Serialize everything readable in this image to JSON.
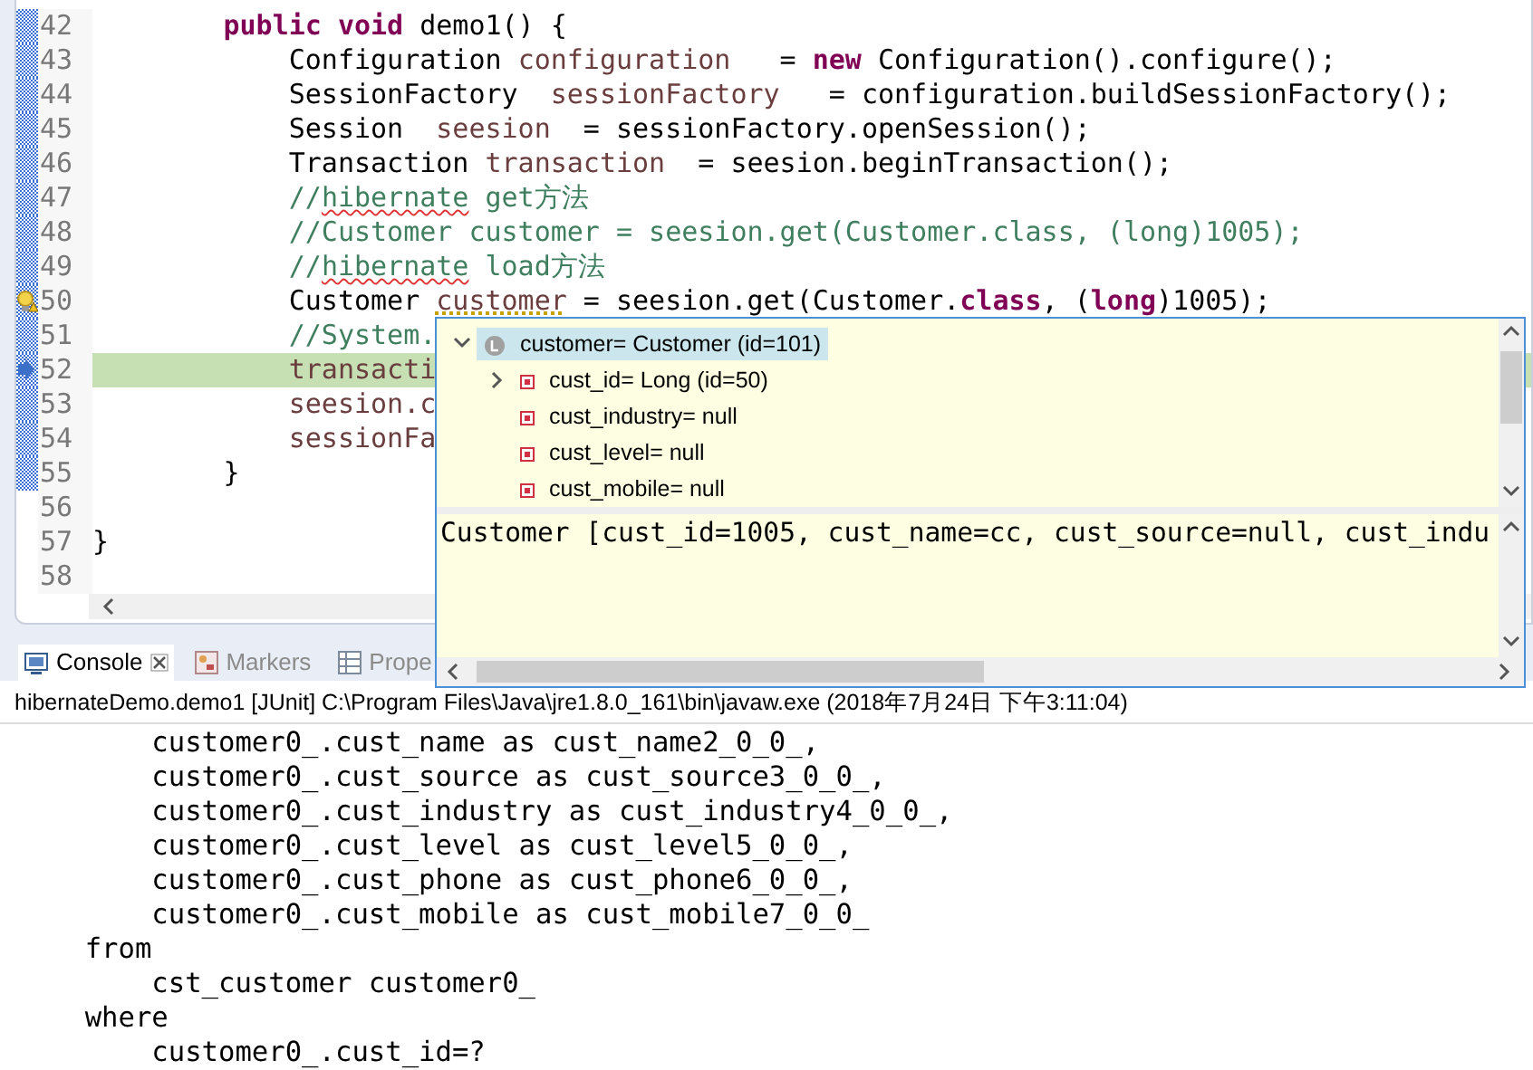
{
  "editor": {
    "lines": [
      {
        "number": "42",
        "in_range": true,
        "current": false,
        "segments": [
          {
            "kind": "keyword",
            "text": "        public"
          },
          {
            "kind": "keyword",
            "text": " void"
          },
          {
            "kind": "plain",
            "text": " demo1() {"
          }
        ]
      },
      {
        "number": "43",
        "in_range": true,
        "current": false,
        "segments": [
          {
            "kind": "plain",
            "text": "            Configuration "
          },
          {
            "kind": "variable",
            "text": "configuration"
          },
          {
            "kind": "plain",
            "text": "   = "
          },
          {
            "kind": "keyword",
            "text": "new"
          },
          {
            "kind": "plain",
            "text": " Configuration().configure();"
          }
        ]
      },
      {
        "number": "44",
        "in_range": true,
        "current": false,
        "segments": [
          {
            "kind": "plain",
            "text": "            SessionFactory  "
          },
          {
            "kind": "variable",
            "text": "sessionFactory"
          },
          {
            "kind": "plain",
            "text": "   = configuration.buildSessionFactory();"
          }
        ]
      },
      {
        "number": "45",
        "in_range": true,
        "current": false,
        "segments": [
          {
            "kind": "plain",
            "text": "            Session  "
          },
          {
            "kind": "variable",
            "text": "seesion"
          },
          {
            "kind": "plain",
            "text": "  = sessionFactory.openSession();"
          }
        ]
      },
      {
        "number": "46",
        "in_range": true,
        "current": false,
        "segments": [
          {
            "kind": "plain",
            "text": "            Transaction "
          },
          {
            "kind": "variable",
            "text": "transaction"
          },
          {
            "kind": "plain",
            "text": "  = seesion.beginTransaction();"
          }
        ]
      },
      {
        "number": "47",
        "in_range": true,
        "current": false,
        "segments": [
          {
            "kind": "comment",
            "text": "            //"
          },
          {
            "kind": "misspelled_comment",
            "text": "hibernate"
          },
          {
            "kind": "comment",
            "text": " get方法"
          }
        ]
      },
      {
        "number": "48",
        "in_range": true,
        "current": false,
        "segments": [
          {
            "kind": "comment",
            "text": "            //Customer customer = seesion.get(Customer.class, (long)1005);"
          }
        ]
      },
      {
        "number": "49",
        "in_range": true,
        "current": false,
        "segments": [
          {
            "kind": "comment",
            "text": "            //"
          },
          {
            "kind": "misspelled_comment",
            "text": "hibernate"
          },
          {
            "kind": "comment",
            "text": " load方法"
          }
        ]
      },
      {
        "number": "50",
        "in_range": true,
        "kind": "warning",
        "current": false,
        "segments": [
          {
            "kind": "plain",
            "text": "            Customer "
          },
          {
            "kind": "warned_variable",
            "text": "customer"
          },
          {
            "kind": "plain",
            "text": " = seesion.get(Customer."
          },
          {
            "kind": "keyword",
            "text": "class"
          },
          {
            "kind": "plain",
            "text": ", ("
          },
          {
            "kind": "keyword",
            "text": "long"
          },
          {
            "kind": "plain",
            "text": ")1005);"
          }
        ]
      },
      {
        "number": "51",
        "in_range": true,
        "current": false,
        "segments": [
          {
            "kind": "comment",
            "text": "            //System."
          }
        ]
      },
      {
        "number": "52",
        "in_range": true,
        "kind": "suspended",
        "current": true,
        "segments": [
          {
            "kind": "variable",
            "text": "            transacti"
          }
        ]
      },
      {
        "number": "53",
        "in_range": true,
        "current": false,
        "segments": [
          {
            "kind": "variable",
            "text": "            seesion.c"
          }
        ]
      },
      {
        "number": "54",
        "in_range": true,
        "current": false,
        "segments": [
          {
            "kind": "variable",
            "text": "            sessionFa"
          }
        ]
      },
      {
        "number": "55",
        "in_range": true,
        "current": false,
        "segments": [
          {
            "kind": "plain",
            "text": "        }"
          }
        ]
      },
      {
        "number": "56",
        "in_range": false,
        "current": false
      },
      {
        "number": "57",
        "in_range": false,
        "current": false,
        "segments": [
          {
            "kind": "plain",
            "text": "}"
          }
        ]
      },
      {
        "number": "58",
        "in_range": false,
        "current": false
      }
    ]
  },
  "debug_popup": {
    "tree": [
      {
        "label": "customer= Customer  (id=101)",
        "expanded": true,
        "selected": true,
        "children": [
          {
            "label": "cust_id= Long  (id=50)",
            "expanded": false
          },
          {
            "label": "cust_industry= null"
          },
          {
            "label": "cust_level= null"
          },
          {
            "label": "cust_mobile= null"
          }
        ]
      }
    ],
    "detail": "Customer [cust_id=1005, cust_name=cc, cust_source=null, cust_indu"
  },
  "console": {
    "tabs": [
      {
        "label": "Console",
        "selected": true,
        "closable": true
      },
      {
        "label": "Markers",
        "selected": false,
        "closable": false
      },
      {
        "label": "Prope",
        "selected": false,
        "closable": false
      }
    ],
    "status": "hibernateDemo.demo1 [JUnit] C:\\Program Files\\Java\\jre1.8.0_161\\bin\\javaw.exe (2018年7月24日 下午3:11:04)",
    "lines": [
      "        customer0_.cust_name as cust_name2_0_0_,",
      "        customer0_.cust_source as cust_source3_0_0_,",
      "        customer0_.cust_industry as cust_industry4_0_0_,",
      "        customer0_.cust_level as cust_level5_0_0_,",
      "        customer0_.cust_phone as cust_phone6_0_0_,",
      "        customer0_.cust_mobile as cust_mobile7_0_0_",
      "    from",
      "        cst_customer customer0_",
      "    where",
      "        customer0_.cust_id=?"
    ]
  }
}
